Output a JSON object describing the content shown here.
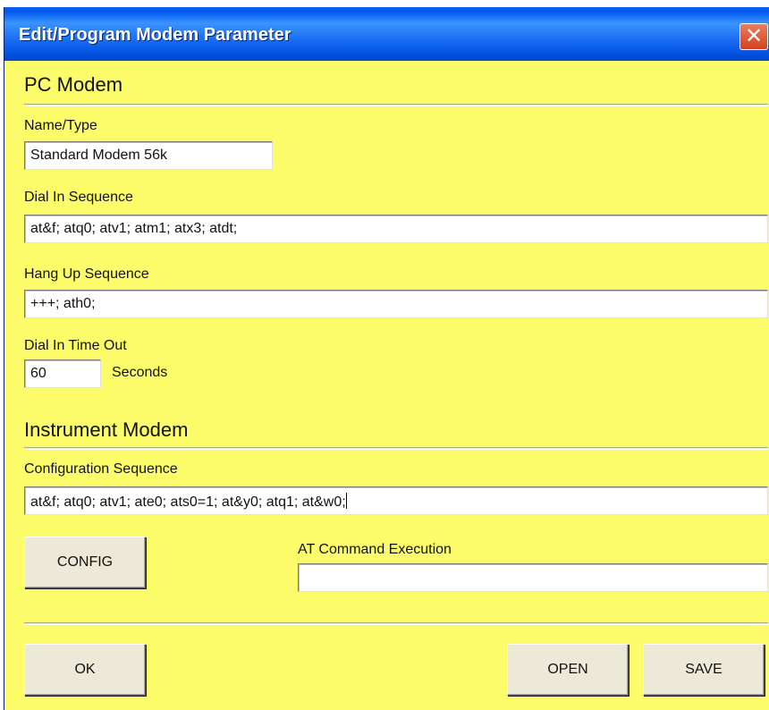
{
  "window": {
    "title": "Edit/Program Modem Parameter",
    "close_glyph": "✕"
  },
  "pc_modem": {
    "heading": "PC Modem",
    "name_label": "Name/Type",
    "name_value": "Standard Modem 56k",
    "dial_in_label": "Dial In Sequence",
    "dial_in_value": "at&f; atq0; atv1; atm1; atx3; atdt;",
    "hang_up_label": "Hang Up Sequence",
    "hang_up_value": "+++; ath0;",
    "timeout_label": "Dial In Time Out",
    "timeout_value": "60",
    "timeout_unit": "Seconds"
  },
  "instrument_modem": {
    "heading": "Instrument Modem",
    "config_label": "Configuration Sequence",
    "config_value": "at&f; atq0; atv1; ate0; ats0=1; at&y0; atq1; at&w0;",
    "config_button": "CONFIG",
    "at_label": "AT Command Execution",
    "at_value": ""
  },
  "buttons": {
    "ok": "OK",
    "open": "OPEN",
    "save": "SAVE"
  },
  "colors": {
    "background": "#fdfd6b",
    "titlebar": "#0058ee",
    "close_button": "#d4421b",
    "button_face": "#ece9d8"
  }
}
